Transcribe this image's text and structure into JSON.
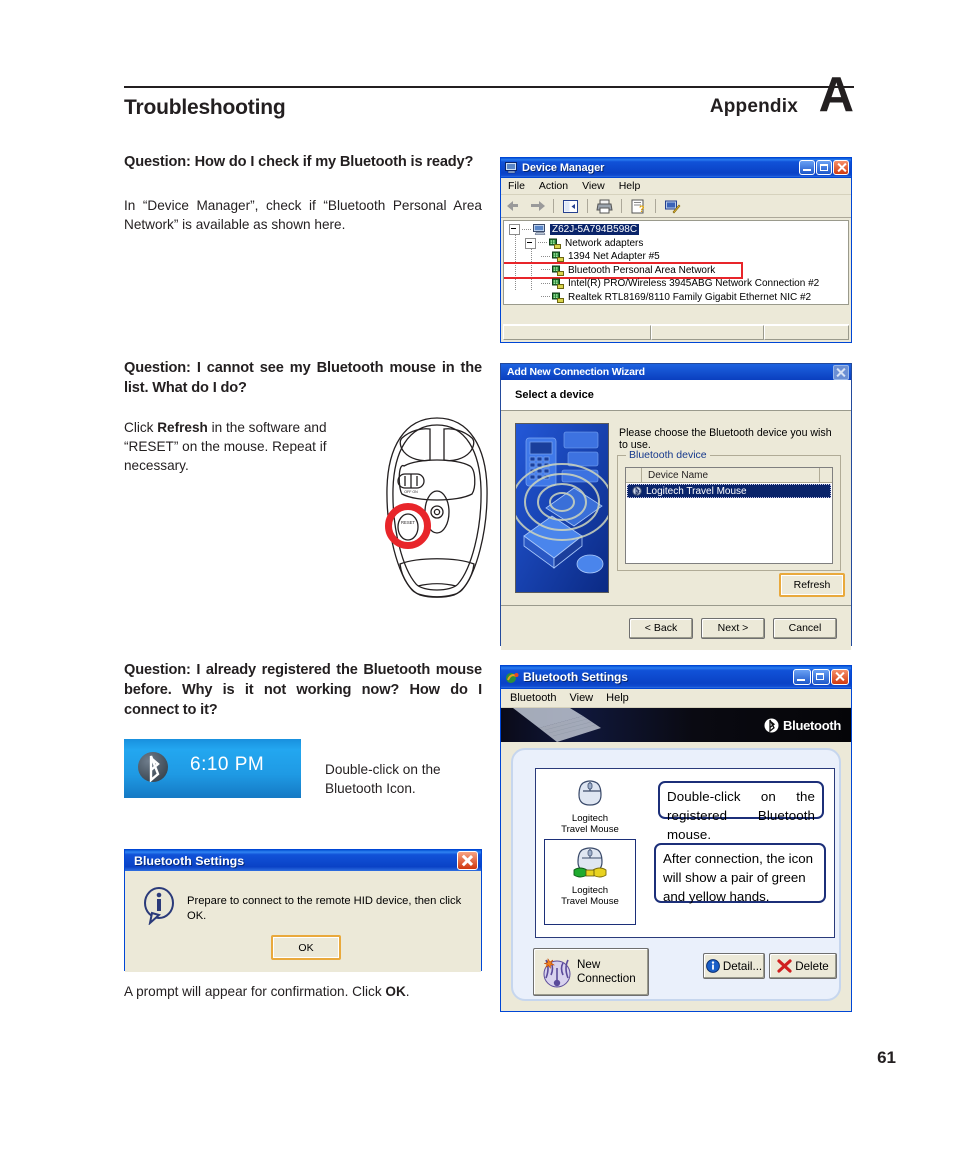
{
  "header": {
    "appendix_label": "Appendix",
    "appendix_letter": "A",
    "section_title": "Troubleshooting"
  },
  "page_number": "61",
  "qa": [
    {
      "question": "Question: How do I check if my Bluetooth is ready?",
      "answer": "In “Device Manager”, check if “Bluetooth Personal Area Network” is available as shown here."
    },
    {
      "question": "Question: I cannot see my Bluetooth mouse in the list. What do I do?",
      "answer_pre": "Click ",
      "answer_bold": "Refresh",
      "answer_post": " in the software and “RESET” on the mouse. Repeat if necessary."
    },
    {
      "question": "Question: I already registered the Bluetooth mouse before. Why is it not working now? How do I connect to it?",
      "tray_caption": "Double-click on the Bluetooth Icon.",
      "prompt_caption_pre": "A prompt will appear for confirmation. Click ",
      "prompt_caption_bold": "OK",
      "prompt_caption_post": "."
    }
  ],
  "systray": {
    "time": "6:10 PM",
    "icon": "bluetooth-icon"
  },
  "mouse_figure": {
    "reset_label": "RESET",
    "switch_label": "OFF  ON"
  },
  "device_manager": {
    "title": "Device Manager",
    "title_icon": "computer-icon",
    "menu": [
      "File",
      "Action",
      "View",
      "Help"
    ],
    "toolbar_icons": [
      "back-arrow-icon",
      "forward-arrow-icon",
      "show-hide-tree-icon",
      "print-icon",
      "properties-icon",
      "scan-hardware-icon"
    ],
    "window_buttons": [
      "minimize-button",
      "maximize-button",
      "close-button"
    ],
    "tree": {
      "root": "Z62J-5A794B598C",
      "category": "Network adapters",
      "devices": [
        "1394 Net Adapter #5",
        "Bluetooth Personal Area Network",
        "Intel(R) PRO/Wireless 3945ABG Network Connection #2",
        "Realtek RTL8169/8110 Family Gigabit Ethernet NIC #2"
      ],
      "highlighted_device": "Bluetooth Personal Area Network"
    }
  },
  "wizard": {
    "title": "Add New Connection Wizard",
    "header": "Select a device",
    "instruction": "Please choose the Bluetooth device you wish to use.",
    "group_label": "Bluetooth device",
    "column_header": "Device Name",
    "list_items": [
      "Logitech Travel Mouse"
    ],
    "refresh_label": "Refresh",
    "back_label": "< Back",
    "next_label": "Next >",
    "cancel_label": "Cancel",
    "close_button": "close-button"
  },
  "bt_settings_window": {
    "title": "Bluetooth Settings",
    "title_icon": "bluetooth-settings-icon",
    "menu": [
      "Bluetooth",
      "View",
      "Help"
    ],
    "brand": "Bluetooth",
    "window_buttons": [
      "minimize-button",
      "maximize-button",
      "close-button"
    ],
    "devices": [
      {
        "name_line1": "Logitech",
        "name_line2": "Travel Mouse",
        "selected": false,
        "connected": false
      },
      {
        "name_line1": "Logitech",
        "name_line2": "Travel Mouse",
        "selected": true,
        "connected": true
      }
    ],
    "callouts": [
      "Double-click on the registered Bluetooth mouse.",
      "After connection, the icon will show a pair of green and yellow hands."
    ],
    "buttons": {
      "new_connection_line1": "New",
      "new_connection_line2": "Connection",
      "detail": "Detail...",
      "delete": "Delete"
    }
  },
  "bt_prompt_dialog": {
    "title": "Bluetooth Settings",
    "icon": "info-icon",
    "message": "Prepare to connect to the remote HID device, then click OK.",
    "ok_label": "OK",
    "close_button": "close-button"
  },
  "colors": {
    "accent_blue": "#0a42c6",
    "highlight_red": "#e8252a",
    "tray_blue": "#1a9ae8",
    "selection_navy": "#0a246a",
    "callout_navy": "#1c2f79"
  }
}
